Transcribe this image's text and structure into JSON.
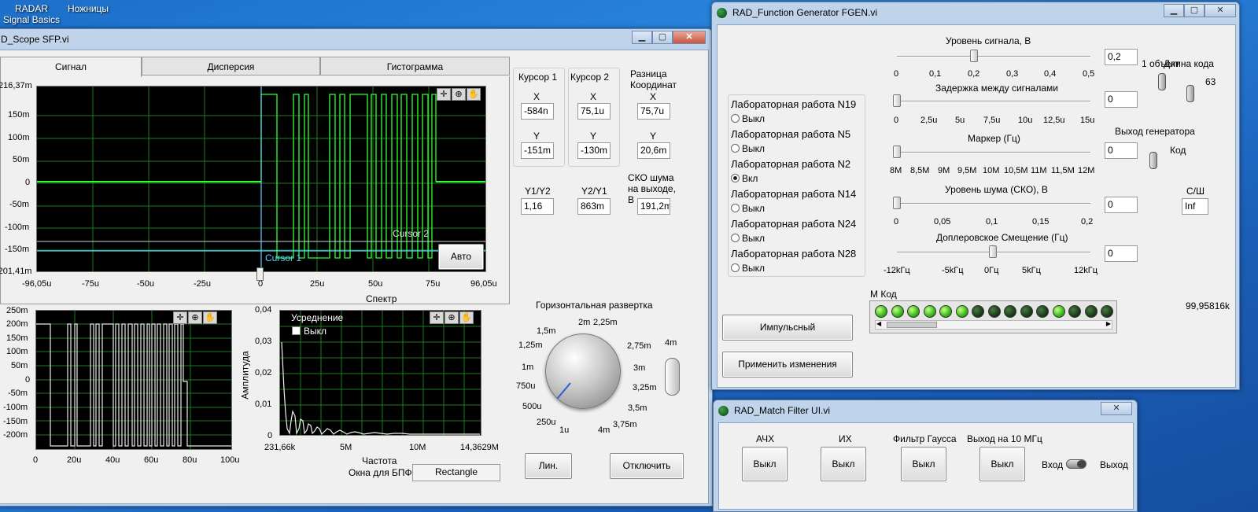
{
  "desktop": {
    "icon1": "RADAR\nSignal Basics",
    "icon2": "Ножницы"
  },
  "scope": {
    "title": "D_Scope SFP.vi",
    "tabs": [
      "Сигнал",
      "Дисперсия",
      "Гистограмма"
    ],
    "main_y_ticks": [
      "216,37m",
      "150m",
      "100m",
      "50m",
      "0",
      "-50m",
      "-100m",
      "-150m",
      "-201,41m"
    ],
    "main_x_ticks": [
      "-96,05u",
      "-75u",
      "-50u",
      "-25u",
      "0",
      "25u",
      "50u",
      "75u",
      "96,05u"
    ],
    "cursor2_label": "Cursor 2",
    "cursor1_label": "Cursor 1",
    "auto_button": "Авто",
    "cursor1_title": "Курсор 1",
    "cursor2_title": "Курсор 2",
    "diff_title": "Разница Координат",
    "x_label": "X",
    "y_label": "Y",
    "c1_x": "-584n",
    "c1_y": "-151m",
    "c2_x": "75,1u",
    "c2_y": "-130m",
    "d_x": "75,7u",
    "d_y": "20,6m",
    "y1y2_label": "Y1/Y2",
    "y2y1_label": "Y2/Y1",
    "noise_label": "СКО шума на выходе, В",
    "y1y2_value": "1,16",
    "y2y1_value": "863m",
    "noise_value": "191,2m",
    "small_y_ticks": [
      "250m",
      "200m",
      "150m",
      "100m",
      "50m",
      "0",
      "-50m",
      "-100m",
      "-150m",
      "-200m"
    ],
    "small_x_ticks": [
      "0",
      "20u",
      "40u",
      "60u",
      "80u",
      "100u"
    ],
    "spectrum_title": "Спектр",
    "spectrum_y_label": "Амплитуда",
    "spectrum_y_ticks": [
      "0,04",
      "0,03",
      "0,02",
      "0,01",
      "0"
    ],
    "spectrum_x_ticks": [
      "231,66k",
      "5M",
      "10M",
      "14,3629M"
    ],
    "spectrum_x_label": "Частота",
    "averaging_label": "Усреднение",
    "averaging_value": "Выкл",
    "fft_window_label": "Окна для БПФ",
    "fft_window_value": "Rectangle",
    "knob_title": "Горизонтальная развертка",
    "knob_ticks": [
      "2m",
      "2,25m",
      "1,5m",
      "2,75m",
      "1,25m",
      "3m",
      "1m",
      "3,25m",
      "750u",
      "3,5m",
      "500u",
      "3,75m",
      "250u",
      "1u",
      "4m"
    ],
    "knob_side_label": "4m",
    "lin_button": "Лин.",
    "off_button": "Отключить"
  },
  "fgen": {
    "title": "RAD_Function Generator FGEN.vi",
    "labs": [
      {
        "name": "Лабораторная работа  N19",
        "state": "Выкл",
        "on": false
      },
      {
        "name": "Лабораторная работа  N5",
        "state": "Выкл",
        "on": false
      },
      {
        "name": "Лабораторная работа  N2",
        "state": "Вкл",
        "on": true
      },
      {
        "name": "Лабораторная работа  N14",
        "state": "Выкл",
        "on": false
      },
      {
        "name": "Лабораторная работа  N24",
        "state": "Выкл",
        "on": false
      },
      {
        "name": "Лабораторная работа  N28",
        "state": "Выкл",
        "on": false
      }
    ],
    "signal_level_label": "Уровень сигнала, В",
    "signal_level_ticks": [
      "0",
      "0,1",
      "0,2",
      "0,3",
      "0,4",
      "0,5"
    ],
    "signal_level_value": "0,2",
    "signal_level_fraction": 0.4,
    "delay_label": "Задержка между сигналами",
    "delay_ticks": [
      "0",
      "2,5u",
      "5u",
      "7,5u",
      "10u",
      "12,5u",
      "15u"
    ],
    "delay_value": "0",
    "marker_label": "Маркер (Гц)",
    "marker_ticks": [
      "8M",
      "8,5M",
      "9M",
      "9,5M",
      "10M",
      "10,5M",
      "11M",
      "11,5M",
      "12M"
    ],
    "marker_value": "0",
    "noise_label": "Уровень шума (СКО), В",
    "noise_ticks": [
      "0",
      "0,05",
      "0,1",
      "0,15",
      "0,2"
    ],
    "noise_value": "0",
    "doppler_label": "Доплеровское Смещение (Гц)",
    "doppler_ticks": [
      "-12kГц",
      "-5kГц",
      "0Гц",
      "5kГц",
      "12kГц"
    ],
    "doppler_value": "0",
    "one_object_label": "1 объект",
    "code_length_label": "Длина кода",
    "code_length_value": "63",
    "gen_output_label": "Выход генератора",
    "code_label": "Код",
    "snr_label": "С/Ш",
    "snr_value": "Inf",
    "mcode_label": "М Код",
    "mcode_leds": [
      1,
      1,
      1,
      1,
      1,
      1,
      0,
      0,
      0,
      0,
      0,
      1,
      0,
      0,
      0
    ],
    "freq_readout": "99,95816k",
    "impulse_button": "Импульсный",
    "apply_button": "Применить изменения"
  },
  "match": {
    "title": "RAD_Match Filter UI.vi",
    "labels": [
      "АЧХ",
      "ИХ",
      "Фильтр Гаусса",
      "Выход на 10 МГц"
    ],
    "button_value": "Выкл",
    "input_label": "Вход",
    "output_label": "Выход"
  }
}
